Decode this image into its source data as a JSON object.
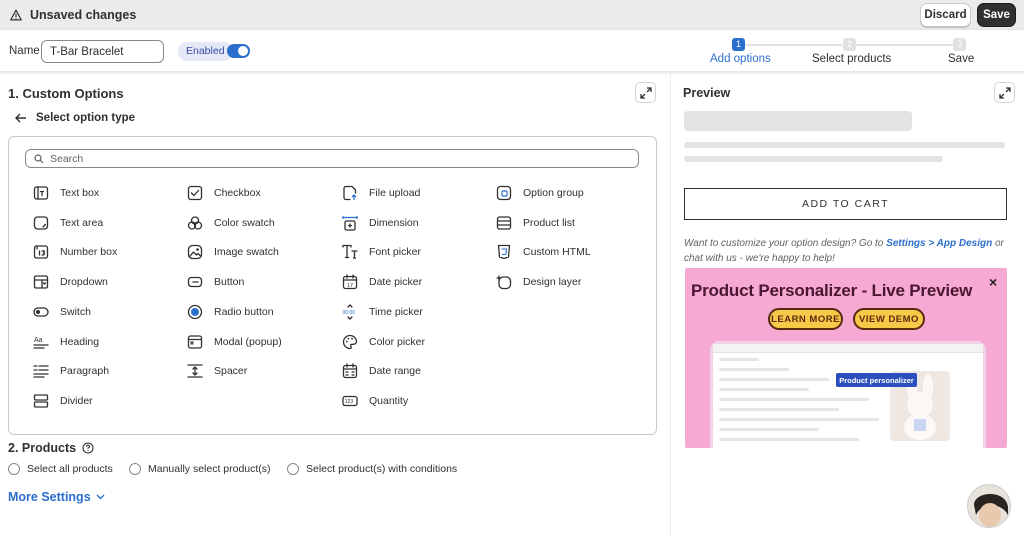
{
  "topbar": {
    "status": "Unsaved changes",
    "discard_label": "Discard",
    "save_label": "Save"
  },
  "namebar": {
    "label": "Name",
    "name_value": "T-Bar Bracelet",
    "enabled_label": "Enabled",
    "enabled": true
  },
  "stepper": {
    "steps": [
      {
        "num": "1",
        "label": "Add options",
        "active": true
      },
      {
        "num": "2",
        "label": "Select products",
        "active": false
      },
      {
        "num": "3",
        "label": "Save",
        "active": false
      }
    ]
  },
  "custom_options": {
    "title": "1. Custom Options",
    "back_label": "Select option type",
    "search_placeholder": "Search",
    "columns": [
      [
        {
          "label": "Text box",
          "icon": "text-box-icon"
        },
        {
          "label": "Text area",
          "icon": "text-area-icon"
        },
        {
          "label": "Number box",
          "icon": "number-box-icon"
        },
        {
          "label": "Dropdown",
          "icon": "dropdown-icon"
        },
        {
          "label": "Switch",
          "icon": "switch-icon"
        },
        {
          "label": "Heading",
          "icon": "heading-icon"
        },
        {
          "label": "Paragraph",
          "icon": "paragraph-icon"
        },
        {
          "label": "Divider",
          "icon": "divider-icon"
        }
      ],
      [
        {
          "label": "Checkbox",
          "icon": "checkbox-icon"
        },
        {
          "label": "Color swatch",
          "icon": "color-swatch-icon"
        },
        {
          "label": "Image swatch",
          "icon": "image-swatch-icon"
        },
        {
          "label": "Button",
          "icon": "button-icon"
        },
        {
          "label": "Radio button",
          "icon": "radio-button-icon"
        },
        {
          "label": "Modal (popup)",
          "icon": "modal-icon"
        },
        {
          "label": "Spacer",
          "icon": "spacer-icon"
        }
      ],
      [
        {
          "label": "File upload",
          "icon": "file-upload-icon"
        },
        {
          "label": "Dimension",
          "icon": "dimension-icon"
        },
        {
          "label": "Font picker",
          "icon": "font-picker-icon"
        },
        {
          "label": "Date picker",
          "icon": "date-picker-icon"
        },
        {
          "label": "Time picker",
          "icon": "time-picker-icon"
        },
        {
          "label": "Color picker",
          "icon": "color-picker-icon"
        },
        {
          "label": "Date range",
          "icon": "date-range-icon"
        },
        {
          "label": "Quantity",
          "icon": "quantity-icon"
        }
      ],
      [
        {
          "label": "Option group",
          "icon": "option-group-icon"
        },
        {
          "label": "Product list",
          "icon": "product-list-icon"
        },
        {
          "label": "Custom HTML",
          "icon": "custom-html-icon"
        },
        {
          "label": "Design layer",
          "icon": "design-layer-icon"
        }
      ]
    ]
  },
  "products": {
    "title": "2. Products",
    "options": [
      "Select all products",
      "Manually select product(s)",
      "Select product(s) with conditions"
    ]
  },
  "more_settings": "More Settings",
  "preview": {
    "title": "Preview",
    "add_to_cart": "ADD TO CART",
    "help_prefix": "Want to customize your option design? Go to ",
    "help_link": "Settings > App Design",
    "help_suffix": " or chat with us - we're happy to help!"
  },
  "banner": {
    "title": "Product Personalizer - Live Preview",
    "learn_more": "LEARN MORE",
    "view_demo": "VIEW DEMO",
    "badge": "Product personalizer"
  },
  "colors": {
    "accent": "#2c6ecb",
    "banner_bg": "#f6a9d2",
    "button_yellow": "#f7c948"
  }
}
